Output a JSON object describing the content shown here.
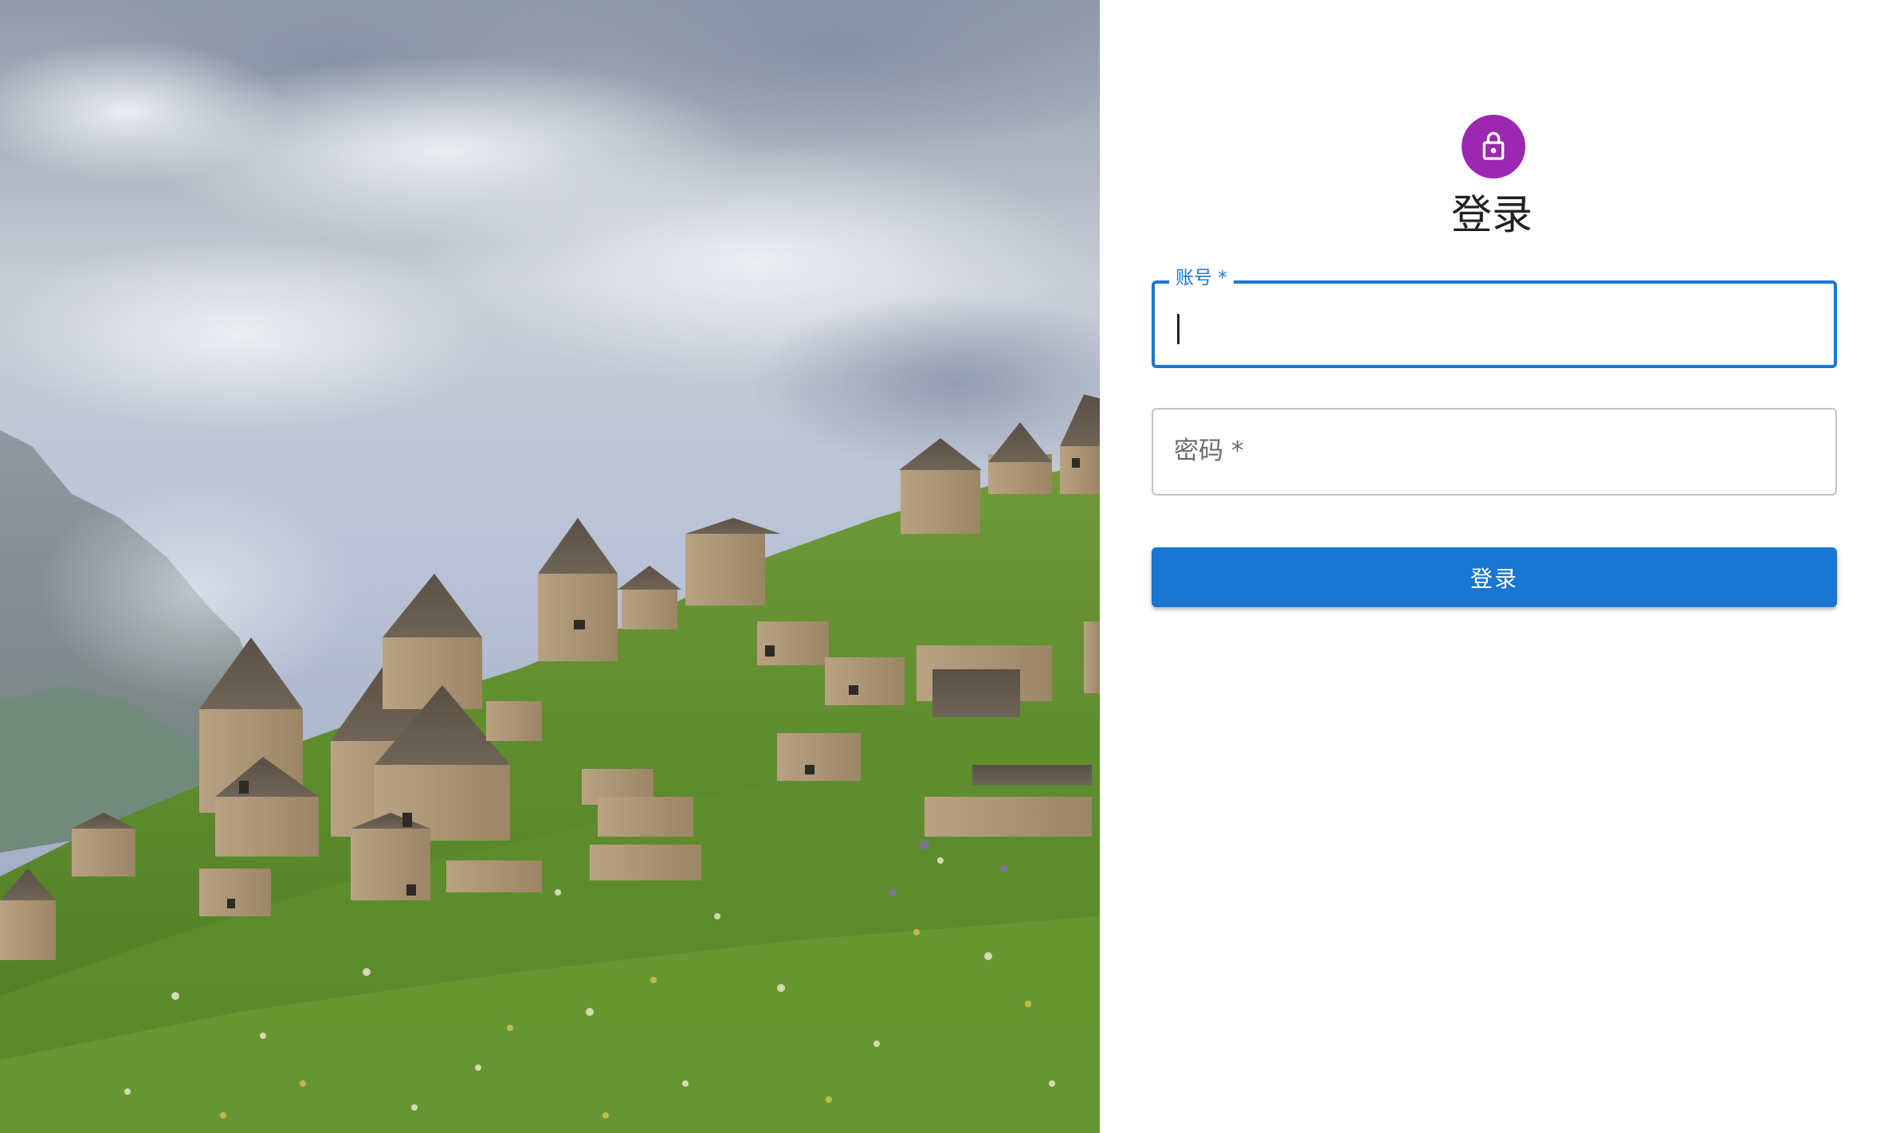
{
  "colors": {
    "avatar_bg": "#9c27b0",
    "primary": "#1976d2",
    "outline_idle": "#c4c4c4",
    "title_text": "#212121"
  },
  "hero": {
    "icon": "landscape-photo"
  },
  "login": {
    "avatar_icon": "lock-icon",
    "title": "登录",
    "account": {
      "label": "账号 *",
      "value": "",
      "focused": true
    },
    "password": {
      "label": "密码 *",
      "value": ""
    },
    "submit_label": "登录"
  }
}
